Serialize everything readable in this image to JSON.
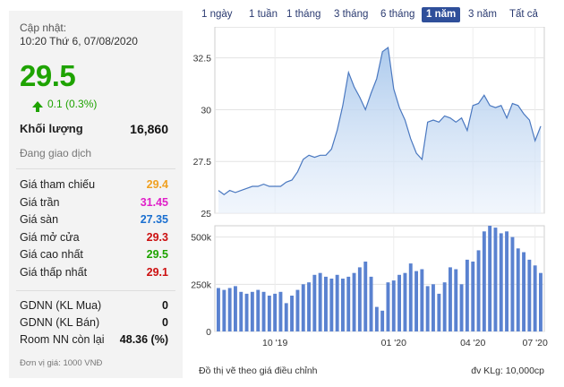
{
  "quote": {
    "updated_label": "Cập nhật:",
    "updated_time": "10:20 Thứ 6, 07/08/2020",
    "price": "29.5",
    "change": "0.1 (0.3%)",
    "volume_label": "Khối lượng",
    "volume_value": "16,860",
    "status": "Đang giao dịch",
    "up_color": "#1ea300"
  },
  "prices": [
    {
      "label": "Giá tham chiếu",
      "value": "29.4",
      "color": "#f0a020"
    },
    {
      "label": "Giá trần",
      "value": "31.45",
      "color": "#e020c8"
    },
    {
      "label": "Giá sàn",
      "value": "27.35",
      "color": "#1a6fd0"
    },
    {
      "label": "Giá mở cửa",
      "value": "29.3",
      "color": "#cc1010"
    },
    {
      "label": "Giá cao nhất",
      "value": "29.5",
      "color": "#1ea300"
    },
    {
      "label": "Giá thấp nhất",
      "value": "29.1",
      "color": "#cc1010"
    }
  ],
  "foreign": [
    {
      "label": "GDNN (KL Mua)",
      "value": "0"
    },
    {
      "label": "GDNN (KL Bán)",
      "value": "0"
    },
    {
      "label": "Room NN còn lại",
      "value": "48.36 (%)"
    }
  ],
  "unit_note": "Đơn vị giá: 1000 VNĐ",
  "tabs": [
    {
      "label": "1 ngày",
      "active": false
    },
    {
      "label": "1 tuần",
      "active": false
    },
    {
      "label": "1 tháng",
      "active": false
    },
    {
      "label": "3 tháng",
      "active": false
    },
    {
      "label": "6 tháng",
      "active": false
    },
    {
      "label": "1 năm",
      "active": true
    },
    {
      "label": "3 năm",
      "active": false
    },
    {
      "label": "Tất cả",
      "active": false
    }
  ],
  "chart_data": {
    "type": "area",
    "x_tick_labels": [
      "10 '19",
      "01 '20",
      "04 '20",
      "07 '20"
    ],
    "price_ticks": [
      "25",
      "27.5",
      "30",
      "32.5"
    ],
    "price_range": [
      25,
      34
    ],
    "prices": [
      26.1,
      25.9,
      26.1,
      26.0,
      26.1,
      26.2,
      26.3,
      26.3,
      26.4,
      26.3,
      26.3,
      26.3,
      26.5,
      26.6,
      27.0,
      27.6,
      27.8,
      27.7,
      27.8,
      27.8,
      28.1,
      29.0,
      30.2,
      31.8,
      31.1,
      30.6,
      30.0,
      30.8,
      31.5,
      32.8,
      33.0,
      31.0,
      30.1,
      29.5,
      28.6,
      27.9,
      27.6,
      29.4,
      29.5,
      29.4,
      29.7,
      29.6,
      29.4,
      29.6,
      29.0,
      30.2,
      30.3,
      30.7,
      30.2,
      30.1,
      30.2,
      29.6,
      30.3,
      30.2,
      29.8,
      29.5,
      28.5,
      29.2
    ],
    "volume_ticks": [
      "0",
      "250k",
      "500k"
    ],
    "volume_range": [
      0,
      560000
    ],
    "volumes": [
      230000,
      220000,
      230000,
      240000,
      210000,
      200000,
      210000,
      220000,
      210000,
      190000,
      200000,
      210000,
      150000,
      190000,
      220000,
      250000,
      260000,
      300000,
      310000,
      290000,
      280000,
      300000,
      280000,
      290000,
      310000,
      340000,
      370000,
      290000,
      130000,
      110000,
      260000,
      270000,
      300000,
      310000,
      360000,
      320000,
      330000,
      240000,
      250000,
      200000,
      260000,
      340000,
      330000,
      250000,
      380000,
      370000,
      430000,
      530000,
      560000,
      550000,
      520000,
      530000,
      500000,
      440000,
      420000,
      380000,
      350000,
      310000
    ],
    "area_color": "#a9c8ec",
    "line_color": "#4a78c0",
    "bar_color": "#5a82d0"
  },
  "footer": {
    "left": "Đồ thị vẽ theo giá điều chỉnh",
    "right": "đv KLg: 10,000cp"
  }
}
